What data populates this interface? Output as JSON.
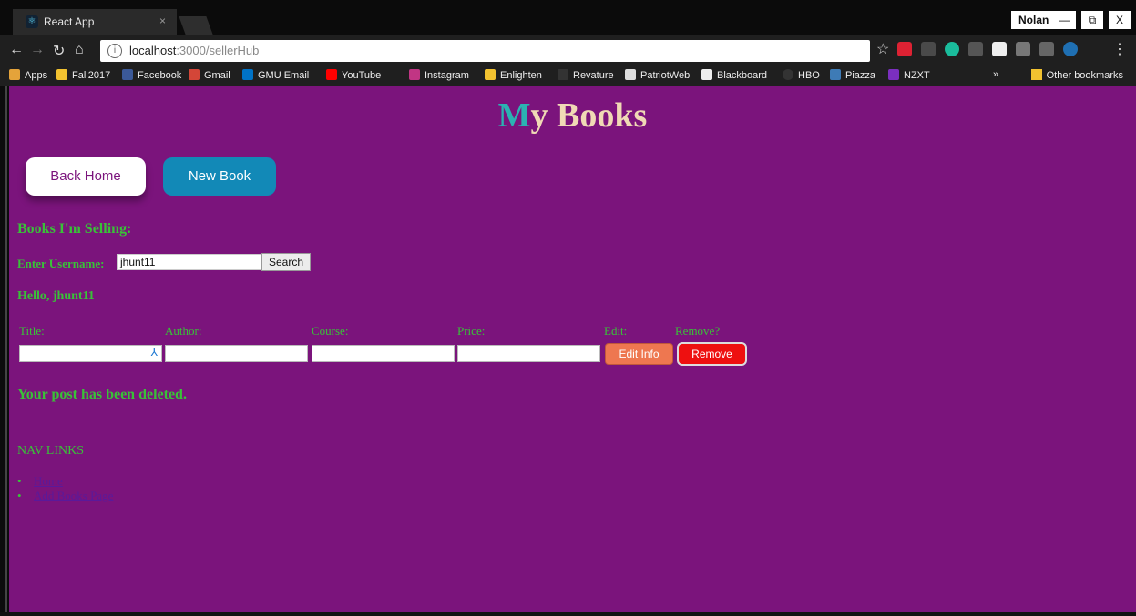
{
  "browser": {
    "tab_title": "React App",
    "tab_close": "×",
    "profile_name": "Nolan",
    "window_buttons": [
      "—",
      "⧉",
      "X"
    ],
    "url_host": "localhost",
    "url_path": ":3000/sellerHub",
    "bookmarks": [
      "Apps",
      "Fall2017",
      "Facebook",
      "Gmail",
      "GMU Email",
      "YouTube",
      "Instagram",
      "Enlighten",
      "Revature",
      "PatriotWeb",
      "Blackboard",
      "HBO",
      "Piazza",
      "NZXT"
    ],
    "bookmarks_overflow": "»",
    "other_bookmarks": "Other bookmarks"
  },
  "page": {
    "title_first_letter": "M",
    "title_rest": "y Books",
    "back_home": "Back Home",
    "new_book": "New Book",
    "selling_heading": "Books I'm Selling:",
    "username_label": "Enter Username:",
    "username_value": "jhunt11",
    "search_label": "Search",
    "hello": "Hello, jhunt11",
    "columns": [
      "Title:",
      "Author:",
      "Course:",
      "Price:",
      "Edit:",
      "Remove?"
    ],
    "edit_label": "Edit Info",
    "remove_label": "Remove",
    "deleted_message": "Your post has been deleted.",
    "nav_title": "NAV LINKS",
    "nav_links": [
      "Home",
      "Add Books Page"
    ]
  },
  "colors": {
    "page_background": "#7b147c",
    "accent_green": "#39c238",
    "title_cream": "#f0d9b5",
    "title_teal": "#2bb3b2"
  }
}
